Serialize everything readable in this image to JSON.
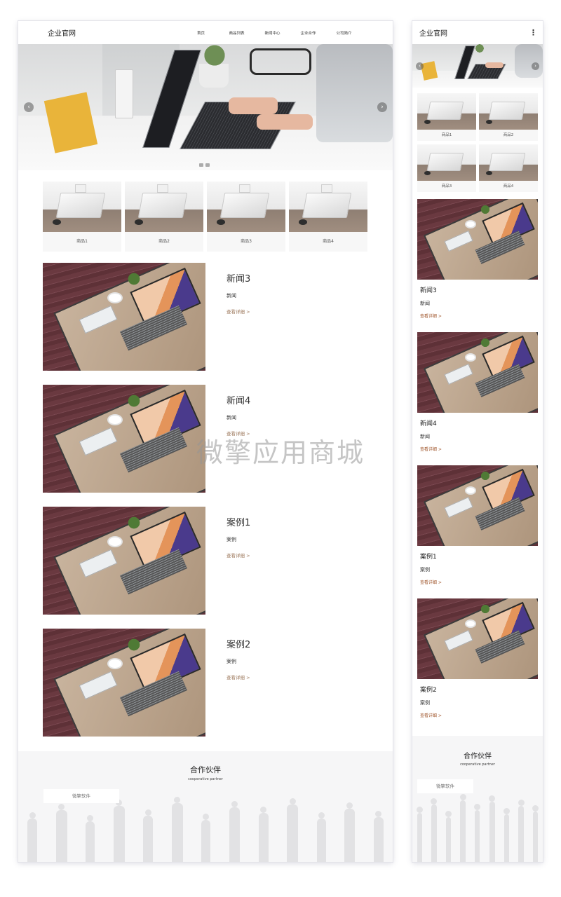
{
  "site": {
    "logo": "企业官网"
  },
  "nav": [
    {
      "label": "首页"
    },
    {
      "label": "商品列表"
    },
    {
      "label": "新闻中心"
    },
    {
      "label": "企业合作"
    },
    {
      "label": "公司简介"
    }
  ],
  "mobile": {
    "menu_icon": "⋮"
  },
  "banner": {
    "prev": "‹",
    "next": "›"
  },
  "products": [
    {
      "label": "商品1"
    },
    {
      "label": "商品2"
    },
    {
      "label": "商品3"
    },
    {
      "label": "商品4"
    }
  ],
  "items": [
    {
      "title": "新闻3",
      "category": "新闻",
      "more": "查看详细 >"
    },
    {
      "title": "新闻4",
      "category": "新闻",
      "more": "查看详细 >"
    },
    {
      "title": "案例1",
      "category": "案例",
      "more": "查看详细 >"
    },
    {
      "title": "案例2",
      "category": "案例",
      "more": "查看详细 >"
    }
  ],
  "partners": {
    "title": "合作伙伴",
    "subtitle": "cooperative partner",
    "card": "微擎软件"
  },
  "watermark": "微擎应用商城"
}
